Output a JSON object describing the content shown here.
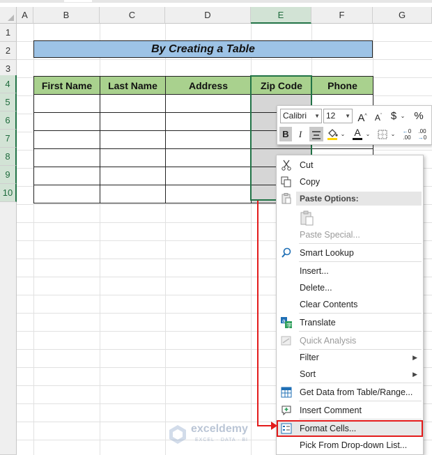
{
  "columns": [
    "A",
    "B",
    "C",
    "D",
    "E",
    "F",
    "G"
  ],
  "rows": [
    "1",
    "2",
    "3",
    "4",
    "5",
    "6",
    "7",
    "8",
    "9",
    "10"
  ],
  "title": "By Creating a Table",
  "table": {
    "headers": [
      "First Name",
      "Last Name",
      "Address",
      "Zip Code",
      "Phone"
    ]
  },
  "mini_toolbar": {
    "font": "Calibri",
    "size": "12",
    "grow_font": "A",
    "shrink_font": "A",
    "currency": "$",
    "percent": "%",
    "bold": "B",
    "italic": "I",
    "font_color_letter": "A",
    "inc_decimal": "←0\n.00",
    "dec_decimal": ".00\n→0"
  },
  "context_menu": {
    "cut": "Cut",
    "copy": "Copy",
    "paste_options": "Paste Options:",
    "paste_special": "Paste Special...",
    "smart_lookup": "Smart Lookup",
    "insert": "Insert...",
    "delete": "Delete...",
    "clear_contents": "Clear Contents",
    "translate": "Translate",
    "quick_analysis": "Quick Analysis",
    "filter": "Filter",
    "sort": "Sort",
    "get_data": "Get Data from Table/Range...",
    "insert_comment": "Insert Comment",
    "format_cells": "Format Cells...",
    "pick_dropdown": "Pick From Drop-down List..."
  },
  "watermark": {
    "name": "exceldemy",
    "tagline": "EXCEL · DATA · BI"
  },
  "colors": {
    "title_fill": "#9dc3e6",
    "header_fill": "#a9d18e",
    "selection": "#217346",
    "highlight": "#e31b1b"
  }
}
